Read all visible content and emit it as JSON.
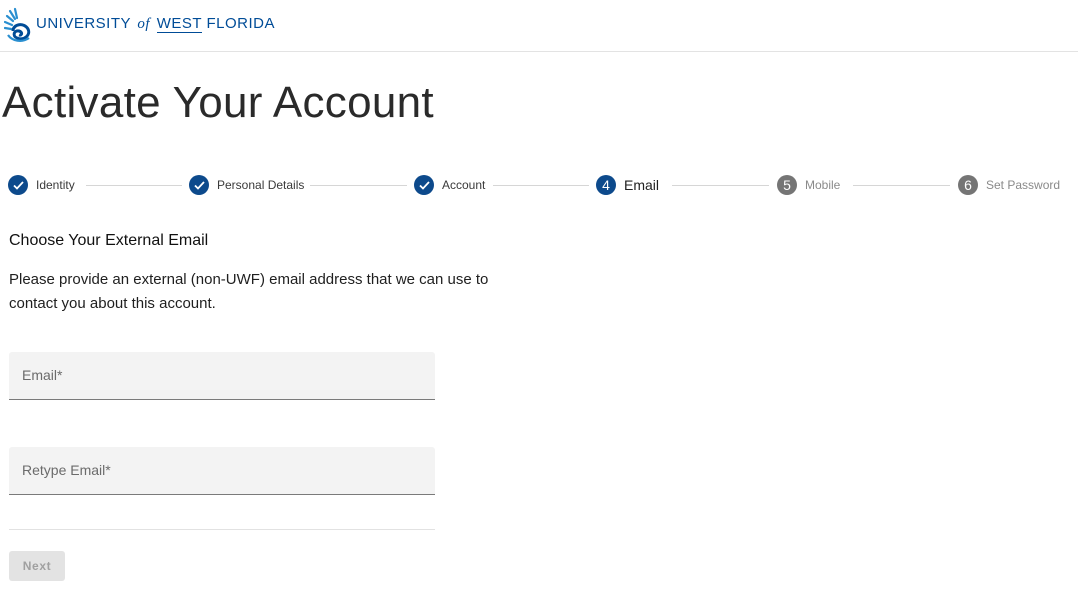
{
  "header": {
    "brand_prefix": "UNIVERSITY",
    "brand_of": "of",
    "brand_west": "WEST",
    "brand_suffix": "FLORIDA",
    "brand_color": "#004c97"
  },
  "page_title": "Activate Your Account",
  "stepper": {
    "steps": [
      {
        "label": "Identity",
        "status": "complete",
        "icon": "check-icon"
      },
      {
        "label": "Personal Details",
        "status": "complete",
        "icon": "check-icon"
      },
      {
        "label": "Account",
        "status": "complete",
        "icon": "check-icon"
      },
      {
        "number": "4",
        "label": "Email",
        "status": "active"
      },
      {
        "number": "5",
        "label": "Mobile",
        "status": "pending"
      },
      {
        "number": "6",
        "label": "Set Password",
        "status": "pending"
      }
    ],
    "active_color": "#0d4a8c",
    "pending_color": "#757575"
  },
  "section": {
    "title": "Choose Your External Email",
    "description": "Please provide an external (non-UWF) email address that we can use to contact you about this account."
  },
  "form": {
    "email_label": "Email*",
    "retype_label": "Retype Email*",
    "next_label": "Next"
  }
}
